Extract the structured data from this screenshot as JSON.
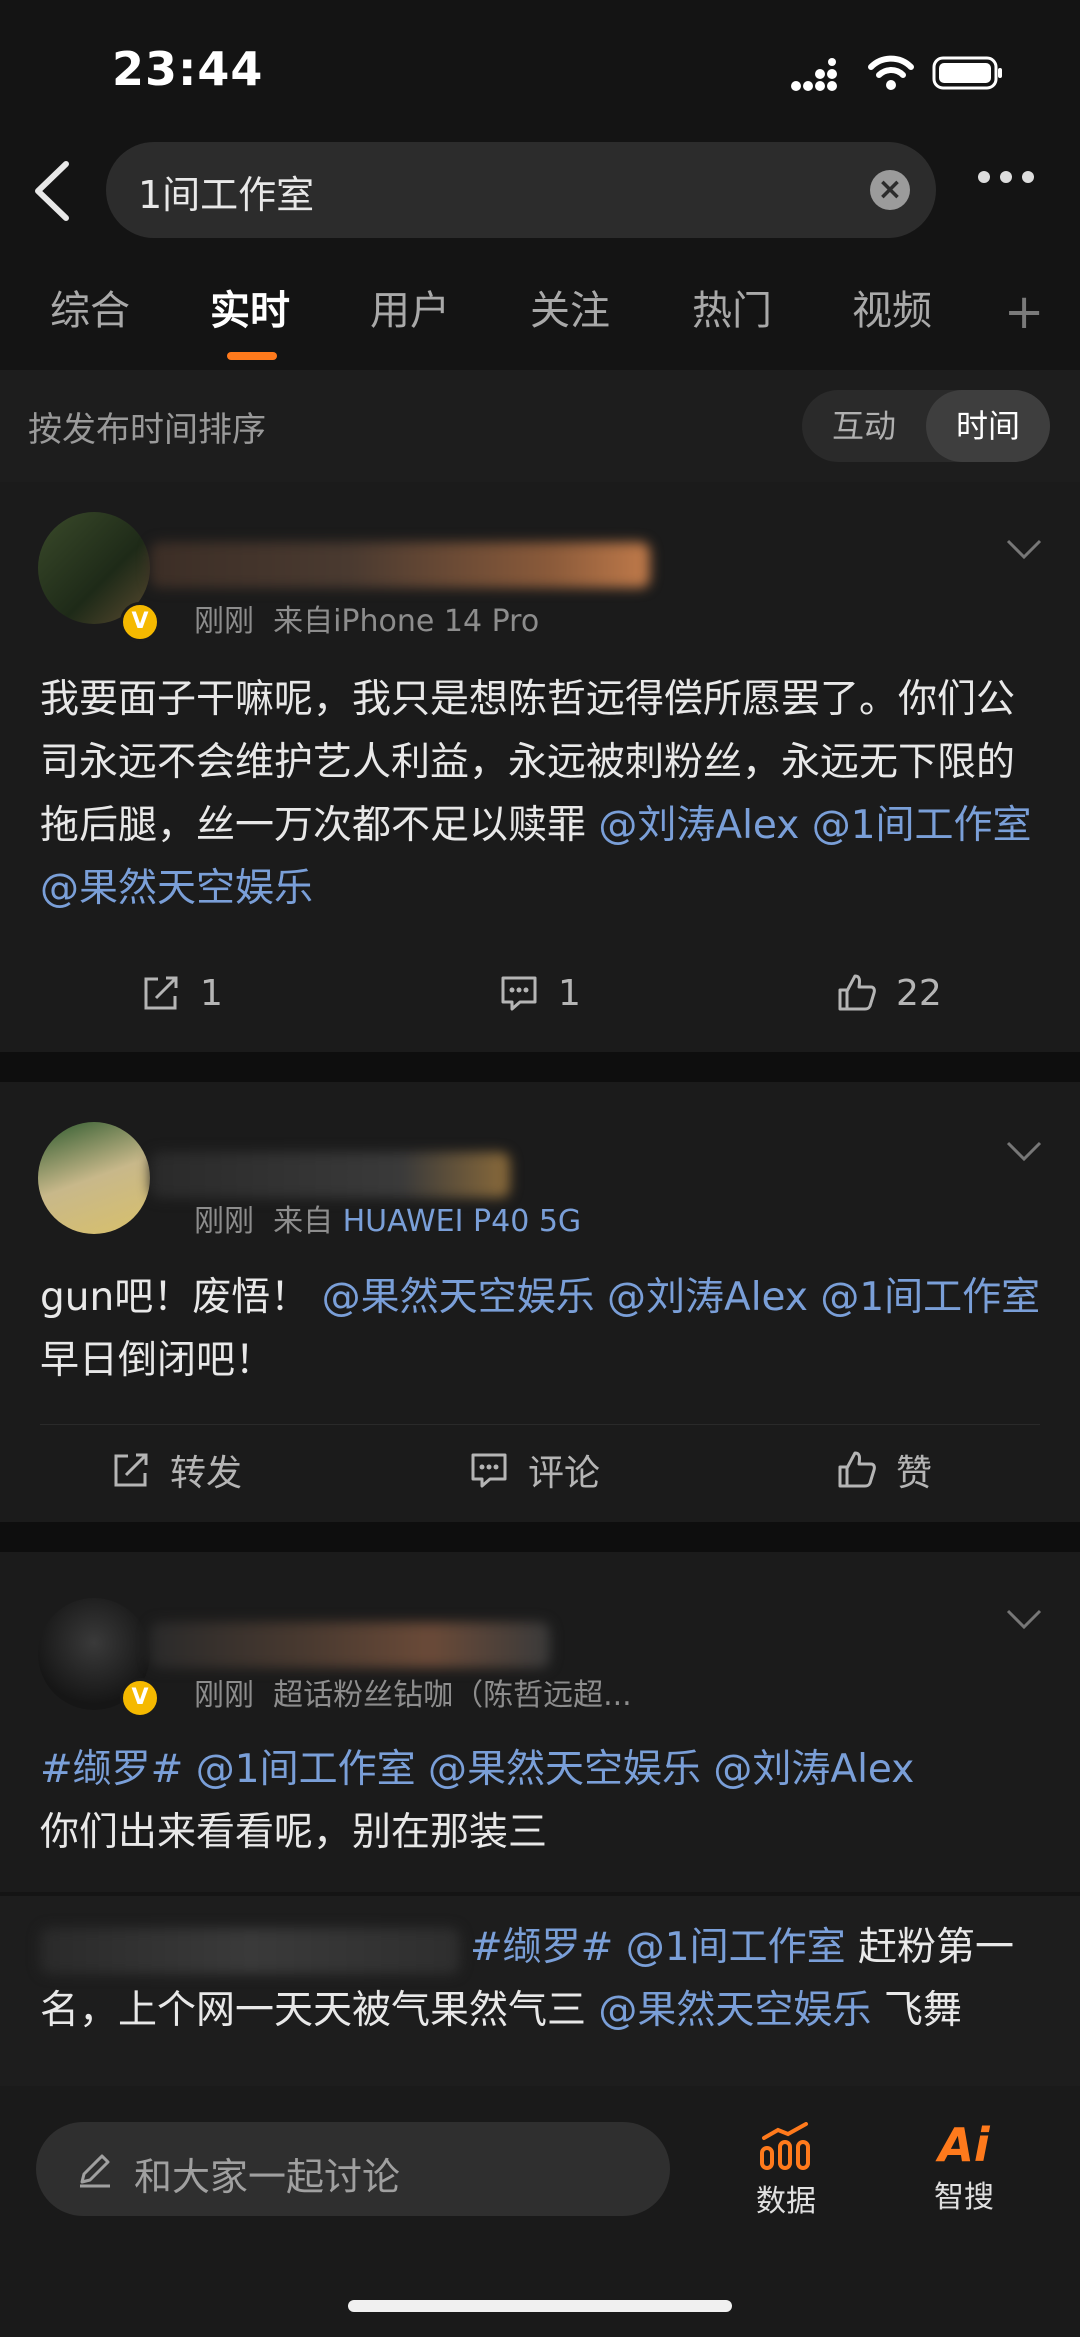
{
  "status": {
    "time": "23:44"
  },
  "search": {
    "query": "1间工作室"
  },
  "tabs": [
    "综合",
    "实时",
    "用户",
    "关注",
    "热门",
    "视频"
  ],
  "sort": {
    "label": "按发布时间排序",
    "options": [
      "互动",
      "时间"
    ],
    "selected": "时间"
  },
  "posts": [
    {
      "meta": "刚刚",
      "source": "来自iPhone 14 Pro",
      "verified": true,
      "segments": [
        "我要面子干嘛呢，我只是想陈哲远得偿所愿罢了。你们公司永远不会维护艺人利益，永远被刺粉丝，永远无下限的拖后腿，丝一万次都不足以赎罪",
        "@刘涛Alex",
        "@1间工作室",
        "@果然天空娱乐"
      ],
      "actions": {
        "repost": "1",
        "comment": "1",
        "like": "22"
      }
    },
    {
      "meta": "刚刚",
      "source": "来自",
      "device": "HUAWEI P40 5G",
      "verified": false,
      "segments": [
        "gun吧！废悟！",
        "@果然天空娱乐",
        "@刘涛Alex",
        "@1间工作室",
        "早日倒闭吧！"
      ],
      "actions": {
        "repost": "转发",
        "comment": "评论",
        "like": "赞"
      }
    },
    {
      "meta": "刚刚",
      "source": "超话粉丝钻咖（陈哲远超...",
      "verified": true,
      "segments": [
        "#缬罗#",
        "@1间工作室",
        "@果然天空娱乐",
        "@刘涛Alex",
        "你们出来看看呢，别在那装三"
      ]
    },
    {
      "segments": [
        "#缬罗#",
        "@1间工作室",
        "赶粉第一名，上个网一天天被气果然气三",
        "@果然天空娱乐",
        "飞舞"
      ]
    }
  ],
  "bottom": {
    "discuss_placeholder": "和大家一起讨论",
    "data_label": "数据",
    "ai_label": "智搜",
    "ai_icon_text": "Ai"
  },
  "colors": {
    "accent": "#ff7a1c",
    "mention": "#7a9fd8",
    "background": "#141414"
  }
}
